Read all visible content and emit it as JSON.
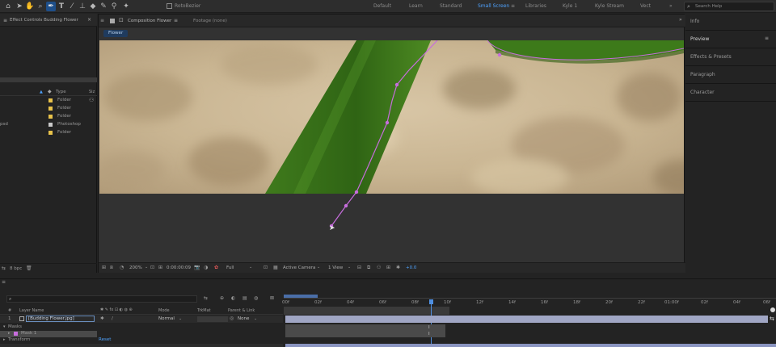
{
  "toolbar": {
    "tool_label": "RotoBezier",
    "workspaces": [
      "Default",
      "Learn",
      "Standard",
      "Small Screen",
      "Libraries",
      "Kyle 1",
      "Kyle Stream",
      "Vect"
    ],
    "active_workspace": "Small Screen",
    "search_placeholder": "Search Help"
  },
  "left_panel": {
    "tab_label": "Effect Controls Budding Flower",
    "column_type": "Type",
    "items": [
      {
        "type": "Folder",
        "color": "#e8c24a"
      },
      {
        "type": "Folder",
        "color": "#e8c24a"
      },
      {
        "type": "Folder",
        "color": "#e8c24a"
      },
      {
        "type": "Photoshop",
        "color": "#c9c9c9",
        "name_fragment": "psd"
      },
      {
        "type": "Folder",
        "color": "#e8c24a"
      }
    ],
    "bpc": "8 bpc"
  },
  "composition": {
    "tab_label": "Composition Flower",
    "footage_tab": "Footage (none)",
    "breadcrumb": "Flower",
    "zoom": "200%",
    "timecode": "0:00:00:09",
    "resolution": "Full",
    "camera": "Active Camera",
    "views": "1 View",
    "exposure": "+0.0"
  },
  "right_panel": {
    "items": [
      "Info",
      "Preview",
      "Effects & Presets",
      "Paragraph",
      "Character"
    ]
  },
  "timeline": {
    "search_placeholder": "",
    "ticks": [
      "00f",
      "02f",
      "04f",
      "06f",
      "08f",
      "10f",
      "12f",
      "14f",
      "16f",
      "18f",
      "20f",
      "22f",
      "01:00f",
      "02f",
      "04f",
      "06f"
    ],
    "columns": {
      "layer_name": "Layer Name",
      "mode": "Mode",
      "trkmat": "TrkMat",
      "parent": "Parent & Link"
    },
    "layers": [
      {
        "number": "1",
        "name": "[Budding Flower.jpg]",
        "mode": "Normal",
        "parent": "None"
      }
    ],
    "masks_label": "Masks",
    "mask_name": "Mask 1",
    "transform_label": "Transform",
    "reset_label": "Reset"
  }
}
